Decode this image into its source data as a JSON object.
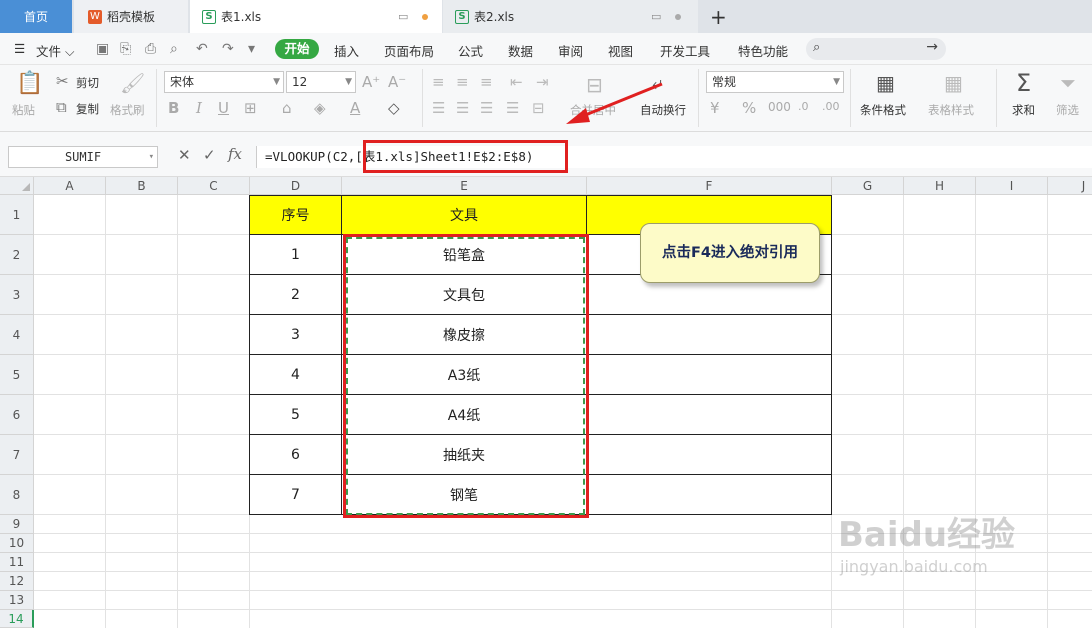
{
  "tabs": [
    {
      "label": "首页"
    },
    {
      "label": "稻壳模板"
    },
    {
      "label": "表1.xls"
    },
    {
      "label": "表2.xls"
    }
  ],
  "menu": {
    "file": "文件",
    "start": "开始",
    "items": [
      "插入",
      "页面布局",
      "公式",
      "数据",
      "审阅",
      "视图",
      "开发工具",
      "特色功能"
    ]
  },
  "ribbon": {
    "paste": "粘贴",
    "cut": "剪切",
    "copy": "复制",
    "format_painter": "格式刷",
    "font_name": "宋体",
    "font_size": "12",
    "merge_center": "合并居中",
    "wrap": "自动换行",
    "number_format": "常规",
    "cond_format": "条件格式",
    "table_style": "表格样式",
    "sum": "求和",
    "filter": "筛选"
  },
  "formula_bar": {
    "name_box": "SUMIF",
    "formula": "=VLOOKUP(C2,[表1.xls]Sheet1!E$2:E$8)"
  },
  "sheet": {
    "columns": [
      "A",
      "B",
      "C",
      "D",
      "E",
      "F",
      "G",
      "H",
      "I",
      "J"
    ],
    "rows": [
      "1",
      "2",
      "3",
      "4",
      "5",
      "6",
      "7",
      "8",
      "9",
      "10",
      "11",
      "12",
      "13",
      "14"
    ],
    "table_header": {
      "d": "序号",
      "e": "文具",
      "f": ""
    },
    "table_rows": [
      {
        "d": "1",
        "e": "铅笔盒"
      },
      {
        "d": "2",
        "e": "文具包"
      },
      {
        "d": "3",
        "e": "橡皮擦"
      },
      {
        "d": "4",
        "e": "A3纸"
      },
      {
        "d": "5",
        "e": "A4纸"
      },
      {
        "d": "6",
        "e": "抽纸夹"
      },
      {
        "d": "7",
        "e": "钢笔"
      }
    ]
  },
  "callout": "点击F4进入绝对引用",
  "watermark": {
    "line1": "Baidu经验",
    "line2": "jingyan.baidu.com"
  },
  "colors": {
    "accent_green": "#35a843",
    "home_tab": "#4a8fd6",
    "highlight_yellow": "#ffff00",
    "annotation_red": "#e02020"
  }
}
